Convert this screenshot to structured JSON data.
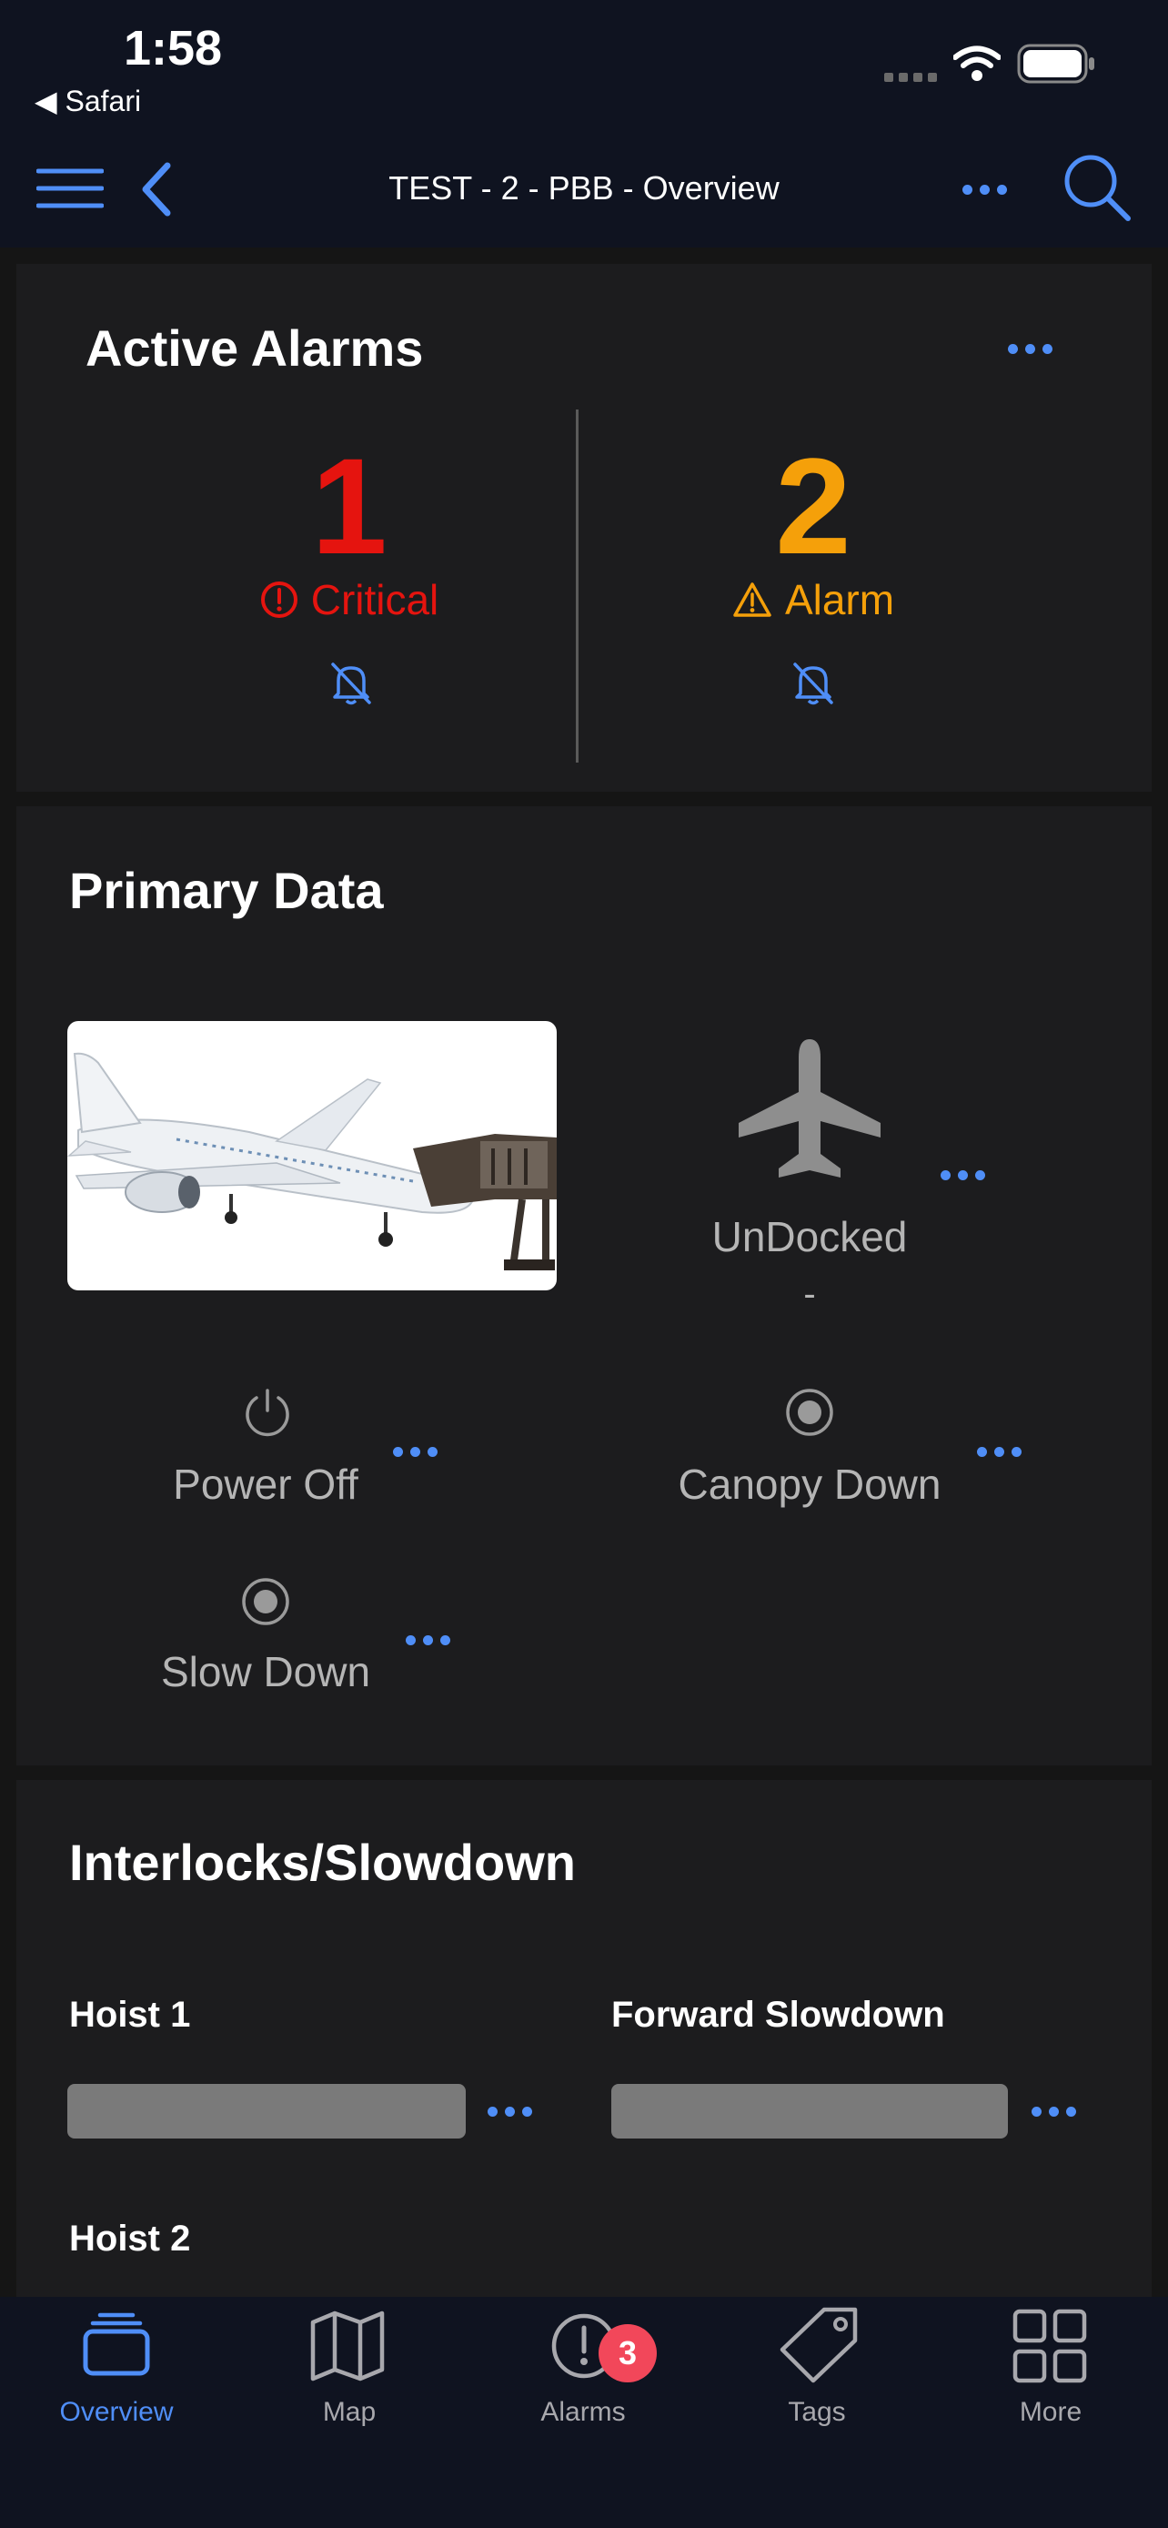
{
  "status_bar": {
    "time": "1:58",
    "back_app": "◀ Safari"
  },
  "nav": {
    "title": "TEST - 2 - PBB - Overview"
  },
  "active_alarms": {
    "title": "Active Alarms",
    "critical": {
      "count": "1",
      "label": "Critical",
      "color": "#e5140f"
    },
    "alarm": {
      "count": "2",
      "label": "Alarm",
      "color": "#f5a00a"
    }
  },
  "primary_data": {
    "title": "Primary Data",
    "dock_status": "UnDocked",
    "dock_sub": "-",
    "power": "Power Off",
    "canopy": "Canopy Down",
    "slow": "Slow Down"
  },
  "interlocks": {
    "title": "Interlocks/Slowdown",
    "items": [
      {
        "label": "Hoist 1"
      },
      {
        "label": "Forward Slowdown"
      },
      {
        "label": "Hoist 2"
      }
    ]
  },
  "tabbar": {
    "tabs": [
      {
        "label": "Overview",
        "icon": "layers-icon",
        "active": true
      },
      {
        "label": "Map",
        "icon": "map-icon"
      },
      {
        "label": "Alarms",
        "icon": "alarm-exclamation-icon",
        "badge": "3"
      },
      {
        "label": "Tags",
        "icon": "tag-icon"
      },
      {
        "label": "More",
        "icon": "grid-icon"
      }
    ]
  },
  "colors": {
    "accent": "#4f8ef7",
    "background": "#151515",
    "card": "#1c1c1e"
  }
}
